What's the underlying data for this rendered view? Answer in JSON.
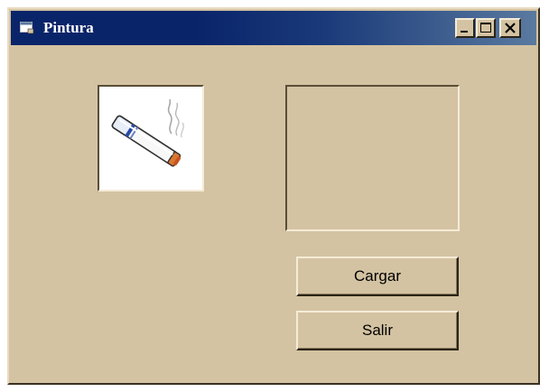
{
  "window": {
    "title": "Pintura",
    "icon": "app-window-icon",
    "controls": [
      "minimize-icon",
      "maximize-icon",
      "close-icon"
    ]
  },
  "picture_left": {
    "icon": "cigarette-icon"
  },
  "buttons": {
    "cargar_label": "Cargar",
    "salir_label": "Salir"
  },
  "colors": {
    "titlebar": "#0a246a",
    "form_background": "#d4c3a2",
    "title_text": "#ffffff"
  }
}
